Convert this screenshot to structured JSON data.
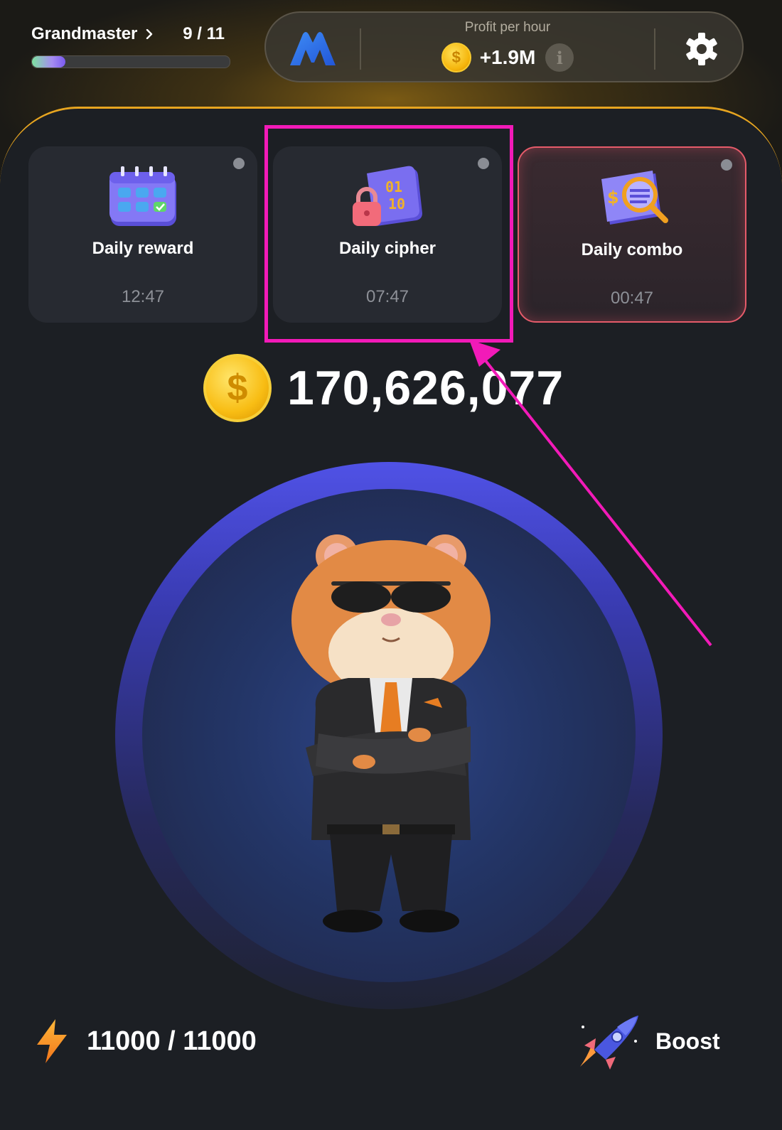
{
  "level": {
    "name": "Grandmaster",
    "count": "9 / 11",
    "progress": 0.17
  },
  "header": {
    "profit_label": "Profit per hour",
    "profit_value": "+1.9M",
    "coin_symbol": "$",
    "info_symbol": "i"
  },
  "cards": [
    {
      "title": "Daily reward",
      "timer": "12:47",
      "icon": "calendar-icon",
      "highlighted": false
    },
    {
      "title": "Daily cipher",
      "timer": "07:47",
      "icon": "cipher-lock-icon",
      "highlighted": true
    },
    {
      "title": "Daily combo",
      "timer": "00:47",
      "icon": "combo-magnifier-icon",
      "highlighted": false,
      "alert": true
    }
  ],
  "balance": {
    "value": "170,626,077",
    "coin_symbol": "$"
  },
  "energy": {
    "value": "11000 / 11000"
  },
  "boost": {
    "label": "Boost"
  },
  "colors": {
    "accent": "#e7a520",
    "highlight": "#f21ab8",
    "alert": "#e65b6a",
    "tap_ring": "#5052e6",
    "background": "#1c1f24"
  }
}
